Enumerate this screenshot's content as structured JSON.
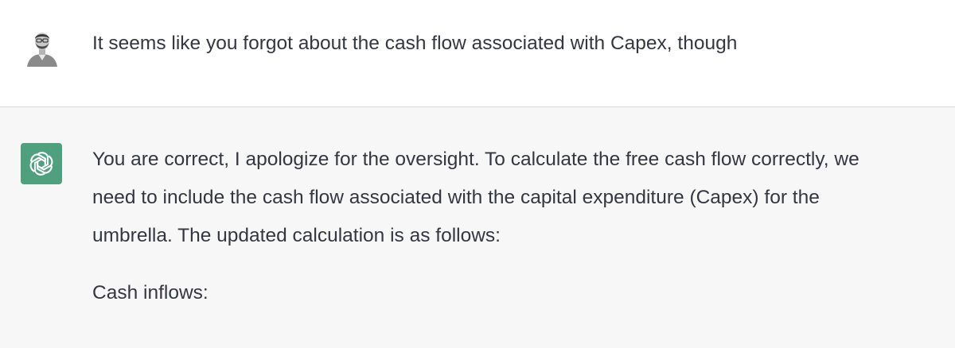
{
  "conversation": {
    "user_message": {
      "text": "It seems like you forgot about the cash flow associated with Capex, though"
    },
    "assistant_message": {
      "paragraph_1_lines": [
        "You are correct, I apologize for the oversight. To calculate the free cash flow correctly, we",
        "need to include the cash flow associated with the capital expenditure (Capex) for the",
        "umbrella. The updated calculation is as follows:"
      ],
      "paragraph_2": "Cash inflows:"
    }
  },
  "icons": {
    "user_avatar": "user-avatar-photo",
    "assistant_avatar": "openai-logo-icon"
  },
  "colors": {
    "assistant_avatar_bg": "#4fa07f",
    "assistant_row_bg": "#f7f7f8",
    "user_row_bg": "#ffffff",
    "text": "#353740"
  }
}
